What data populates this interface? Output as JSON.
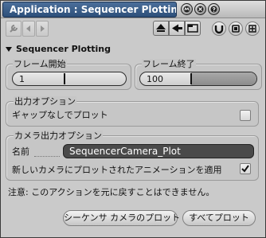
{
  "window": {
    "title": "Application : Sequencer Plotting"
  },
  "title_icons": [
    "maya-logo-icon",
    "close-circle-icon",
    "help-circle-icon"
  ],
  "toolbar": {
    "left_icons": [
      "wrench-icon",
      "arrow-left-icon",
      "arrow-right-icon"
    ],
    "segment_icons": [
      "play-up-icon",
      "play-back-icon",
      "tab-icon"
    ],
    "right_icons": [
      "magnet-icon",
      "gear-icon",
      "settings-icon"
    ]
  },
  "section": {
    "title": "Sequencer Plotting"
  },
  "frame_start": {
    "label": "フレーム開始",
    "value": "1"
  },
  "frame_end": {
    "label": "フレーム終了",
    "value": "100"
  },
  "output_options": {
    "label": "出力オプション",
    "gapless_label": "ギャップなしでプロット",
    "gapless_checked": false
  },
  "camera_options": {
    "label": "カメラ出力オプション",
    "name_label": "名前",
    "name_value": "SequencerCamera_Plot",
    "apply_label": "新しいカメラにプロットされたアニメーションを適用",
    "apply_checked": true
  },
  "note": "注意: このアクションを元に戻すことはできません。",
  "buttons": {
    "plot_sequencer_camera": "シーケンサ カメラのプロット",
    "plot_all": "すべてプロット"
  }
}
